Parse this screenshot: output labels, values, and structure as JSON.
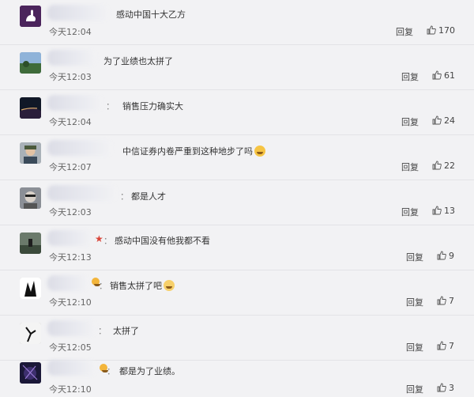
{
  "comments": [
    {
      "text": "感动中国十大乙方",
      "time": "今天12:04",
      "reply": "回复",
      "likes": "170"
    },
    {
      "text": "为了业绩也太拼了",
      "time": "今天12:03",
      "reply": "回复",
      "likes": "61"
    },
    {
      "text": "销售压力确实大",
      "time": "今天12:04",
      "reply": "回复",
      "likes": "24"
    },
    {
      "text": "中信证券内卷严重到这种地步了吗",
      "time": "今天12:07",
      "reply": "回复",
      "likes": "22"
    },
    {
      "text": "都是人才",
      "time": "今天12:03",
      "reply": "回复",
      "likes": "13"
    },
    {
      "text": "感动中国没有他我都不看",
      "time": "今天12:13",
      "reply": "回复",
      "likes": "9"
    },
    {
      "text": "销售太拼了吧",
      "time": "今天12:10",
      "reply": "回复",
      "likes": "7"
    },
    {
      "text": "太拼了",
      "time": "今天12:05",
      "reply": "回复",
      "likes": "7"
    },
    {
      "text": "都是为了业绩。",
      "time": "今天12:10",
      "reply": "回复",
      "likes": "3"
    }
  ],
  "colors": {
    "background": "#f2f2f4",
    "text": "#333333",
    "meta": "#666666"
  },
  "icons": {
    "like": "thumbs-up-icon",
    "emoji": "laughing-face-icon"
  }
}
